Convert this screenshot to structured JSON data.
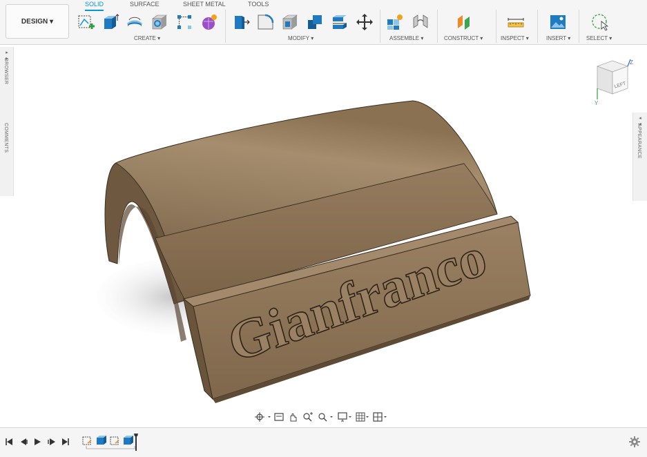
{
  "workspace": {
    "label": "DESIGN ▾"
  },
  "tabs": [
    {
      "label": "SOLID",
      "active": true
    },
    {
      "label": "SURFACE",
      "active": false
    },
    {
      "label": "SHEET METAL",
      "active": false
    },
    {
      "label": "TOOLS",
      "active": false
    }
  ],
  "groups": {
    "create": "CREATE ▾",
    "modify": "MODIFY ▾",
    "assemble": "ASSEMBLE ▾",
    "construct": "CONSTRUCT ▾",
    "inspect": "INSPECT ▾",
    "insert": "INSERT ▾",
    "select": "SELECT ▾"
  },
  "panels": {
    "browser": "BROWSER",
    "comments": "COMMENTS",
    "appearance": "APPEARANCE"
  },
  "viewcube": {
    "face": "LEFT",
    "axis_z": "Z",
    "axis_y": "Y"
  },
  "model": {
    "engraved_text": "Gianfranco",
    "color": "#8c7356"
  },
  "colors": {
    "accent": "#0696d7",
    "model_dark": "#6e573f",
    "model_light": "#a38a6c"
  }
}
